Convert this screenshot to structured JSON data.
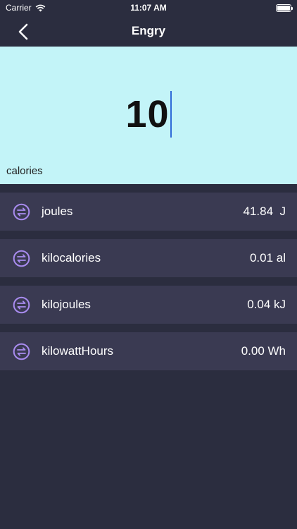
{
  "status_bar": {
    "carrier": "Carrier",
    "time": "11:07 AM"
  },
  "nav": {
    "title": "Engry"
  },
  "input": {
    "value": "10",
    "unit": "calories"
  },
  "results": [
    {
      "name": "joules",
      "value": "41.84  J"
    },
    {
      "name": "kilocalories",
      "value": "0.01 al"
    },
    {
      "name": "kilojoules",
      "value": "0.04 kJ"
    },
    {
      "name": "kilowattHours",
      "value": "0.00 Wh"
    }
  ],
  "colors": {
    "background": "#2b2d3f",
    "input_panel": "#c3f4f8",
    "row_background": "#3a3a52",
    "icon_accent": "#a98cf0",
    "caret": "#2f6bd8"
  }
}
